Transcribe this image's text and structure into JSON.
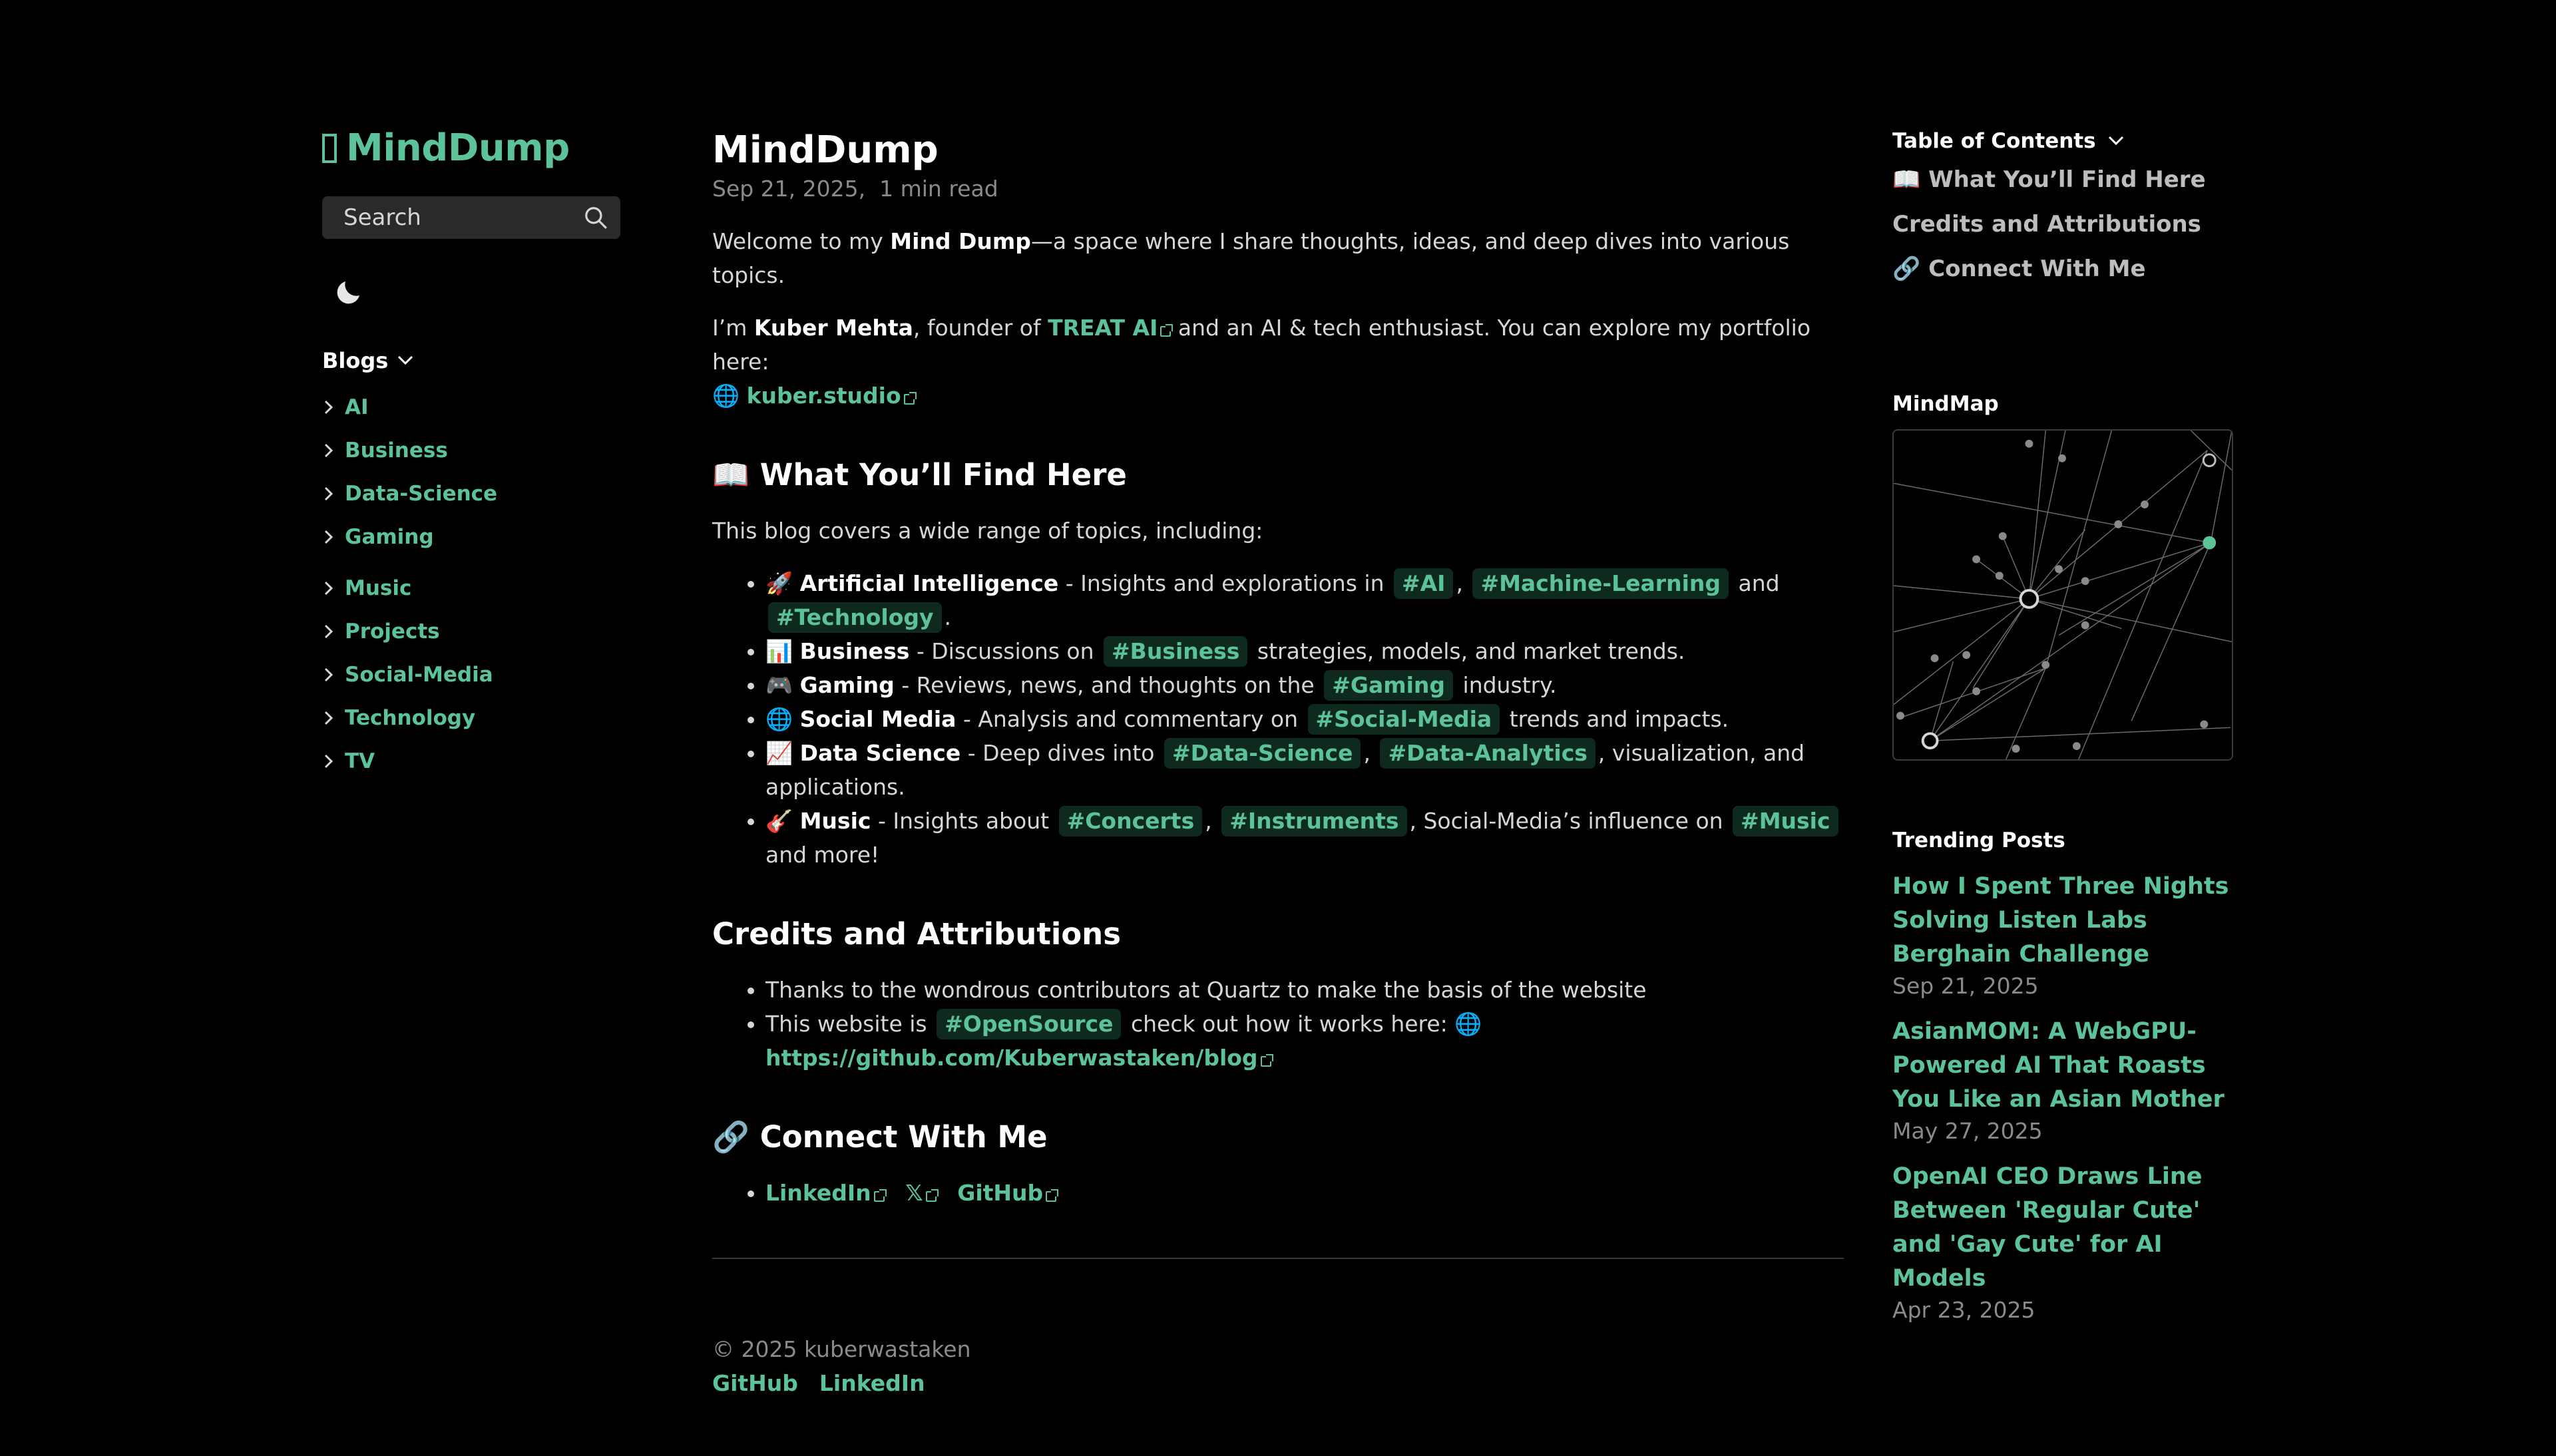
{
  "site": {
    "logo": "MindDump"
  },
  "search": {
    "placeholder": "Search"
  },
  "nav": {
    "header": "Blogs",
    "items": [
      "AI",
      "Business",
      "Data-Science",
      "Gaming",
      "Music",
      "Projects",
      "Social-Media",
      "Technology",
      "TV"
    ]
  },
  "post": {
    "title": "MindDump",
    "date": "Sep 21, 2025",
    "read": "1 min read",
    "intro1_pre": "Welcome to my ",
    "intro1_bold": "Mind Dump",
    "intro1_post": "—a space where I share thoughts, ideas, and deep dives into various topics.",
    "intro2_pre": "I’m ",
    "intro2_name": "Kuber Mehta",
    "intro2_mid": ", founder of ",
    "intro2_link": "TREAT AI",
    "intro2_post": " and an AI & tech enthusiast. You can explore my portfolio here:",
    "portfolio_link": "kuber.studio",
    "find_heading": "📖 What You’ll Find Here",
    "find_intro": "This blog covers a wide range of topics, including:",
    "topics": {
      "ai_name": "Artificial Intelligence",
      "ai_text": " - Insights and explorations in ",
      "ai_tag1": "#AI",
      "ai_tag2": "#Machine-Learning",
      "ai_and": " and ",
      "ai_tag3": "#Technology",
      "ai_end": ".",
      "biz_name": "Business",
      "biz_text": " - Discussions on ",
      "biz_tag": "#Business",
      "biz_end": " strategies, models, and market trends.",
      "game_name": "Gaming",
      "game_text": " - Reviews, news, and thoughts on the ",
      "game_tag": "#Gaming",
      "game_end": " industry.",
      "social_name": "Social Media",
      "social_text": " - Analysis and commentary on ",
      "social_tag": "#Social-Media",
      "social_end": " trends and impacts.",
      "ds_name": "Data Science",
      "ds_text": " - Deep dives into ",
      "ds_tag1": "#Data-Science",
      "ds_tag2": "#Data-Analytics",
      "ds_end": ", visualization, and applications.",
      "music_name": "Music",
      "music_text": " - Insights about ",
      "music_tag1": "#Concerts",
      "music_tag2": "#Instruments",
      "music_mid": ", Social-Media’s influence on ",
      "music_tag3": "#Music",
      "music_end": " and more!"
    },
    "credits_heading": "Credits and Attributions",
    "credit1": "Thanks to the wondrous contributors at Quartz to make the basis of the website",
    "credit2_pre": "This website is ",
    "credit2_tag": "#OpenSource",
    "credit2_post": " check out how it works here: 🌐",
    "credit2_link": "https://github.com/Kuberwastaken/blog",
    "connect_heading": "🔗 Connect With Me",
    "connect_links": [
      "LinkedIn",
      "𝕏",
      "GitHub"
    ]
  },
  "footer": {
    "copyright": "© 2025 kuberwastaken",
    "links": [
      "GitHub",
      "LinkedIn"
    ]
  },
  "toc": {
    "header": "Table of Contents",
    "items": [
      "📖 What You’ll Find Here",
      "Credits and Attributions",
      "🔗 Connect With Me"
    ]
  },
  "mindmap": {
    "header": "MindMap"
  },
  "trending": {
    "header": "Trending Posts",
    "posts": [
      {
        "title": "How I Spent Three Nights Solving Listen Labs Berghain Challenge",
        "date": "Sep 21, 2025"
      },
      {
        "title": "AsianMOM: A WebGPU-Powered AI That Roasts You Like an Asian Mother",
        "date": "May 27, 2025"
      },
      {
        "title": "OpenAI CEO Draws Line Between 'Regular Cute' and 'Gay Cute' for AI Models",
        "date": "Apr 23, 2025"
      }
    ]
  },
  "colors": {
    "accent": "#5cc29a",
    "background": "#000000",
    "text": "#d6d6d6",
    "muted": "#8a8a8a"
  }
}
